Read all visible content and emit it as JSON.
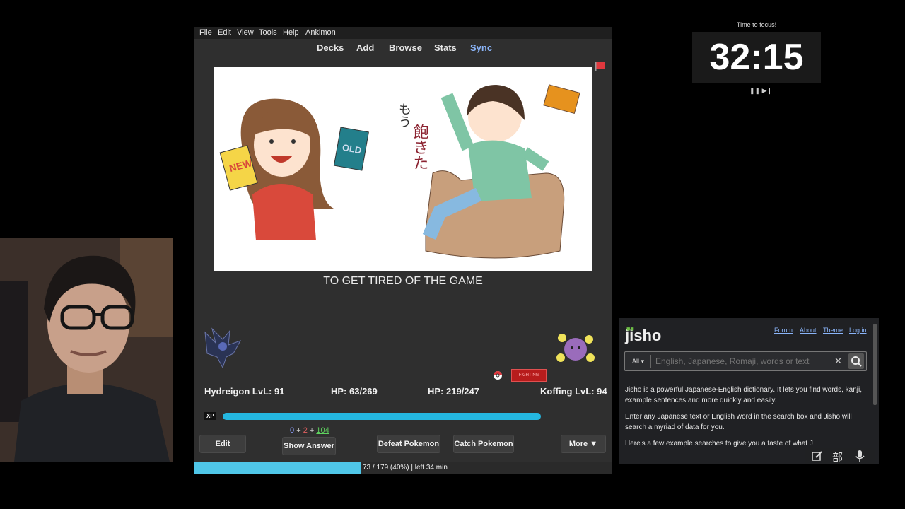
{
  "menubar": {
    "items": [
      {
        "label": "File"
      },
      {
        "label": "Edit"
      },
      {
        "label": "View"
      },
      {
        "label": "Tools"
      },
      {
        "label": "Help"
      },
      {
        "label": "Ankimon"
      }
    ]
  },
  "toolbar": {
    "items": [
      {
        "label": "Decks"
      },
      {
        "label": "Add"
      },
      {
        "label": "Browse"
      },
      {
        "label": "Stats"
      },
      {
        "label": "Sync"
      }
    ],
    "sync_color": "#8ab4f8"
  },
  "card": {
    "image_text": {
      "new_card": "NEW",
      "old_card": "OLD",
      "jp_text_1": "もう",
      "jp_text_2": "飽きた"
    },
    "caption": "TO GET TIRED OF THE GAME"
  },
  "battle": {
    "player_name_level": "Hydreigon LvL: 91",
    "player_hp": "HP: 63/269",
    "enemy_hp": "HP: 219/247",
    "enemy_name_level": "Koffing LvL: 94",
    "enemy_type": "FIGHTING",
    "xp_label": "XP",
    "xp_fraction": 0.995
  },
  "review_counts": {
    "new": "0",
    "plus1": "+",
    "learn": "2",
    "plus2": "+",
    "due": "104"
  },
  "buttons": {
    "edit": "Edit",
    "show_answer": "Show Answer",
    "defeat": "Defeat Pokemon",
    "catch": "Catch Pokemon",
    "more": "More ▼"
  },
  "progress": {
    "text": "73 / 179 (40%) | left 34 min",
    "fraction": 0.4
  },
  "timer": {
    "label": "Time to focus!",
    "value": "32:15",
    "controls": "❚❚ ▶❙"
  },
  "jisho": {
    "logo": "jisho",
    "links": [
      "Forum",
      "About",
      "Theme",
      "Log in"
    ],
    "search_scope": "All ▾",
    "search_placeholder": "English, Japanese, Romaji, words or text",
    "clear_icon": "✕",
    "paragraphs": [
      "Jisho is a powerful Japanese-English dictionary. It lets you find words, kanji, example sentences and more quickly and easily.",
      "Enter any Japanese text or English word in the search box and Jisho will search a myriad of data for you.",
      "Here's a few example searches to give you a taste of what J"
    ],
    "footer_icons": [
      "edit-icon",
      "radical-icon",
      "microphone-icon"
    ],
    "radical_glyph": "部"
  }
}
